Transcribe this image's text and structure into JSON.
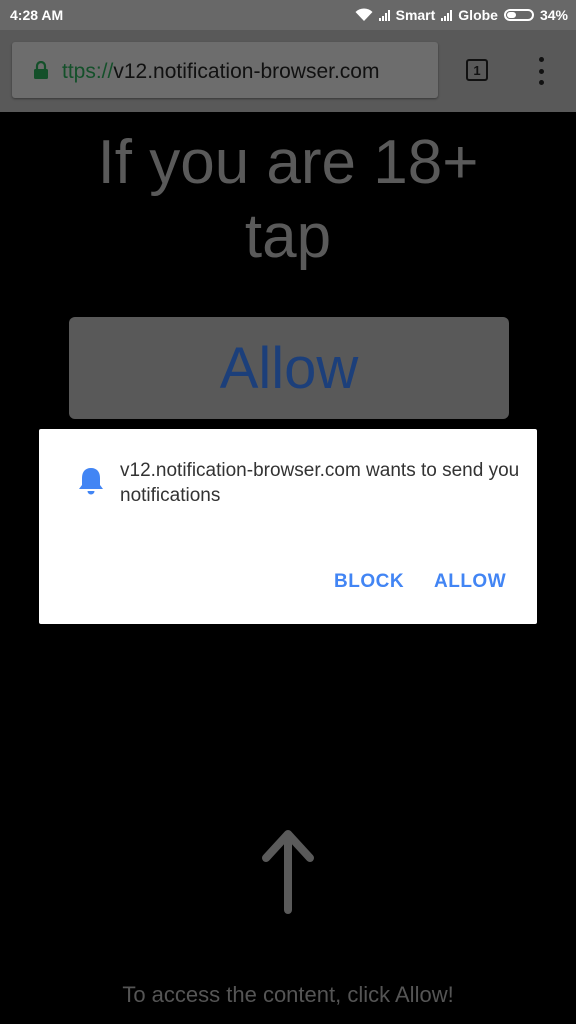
{
  "status_bar": {
    "time": "4:28 AM",
    "carrier1": "Smart",
    "carrier2": "Globe",
    "battery": "34%"
  },
  "browser": {
    "url_scheme": "ttps://",
    "url_host": "v12.notification-browser.com",
    "tab_count": "1"
  },
  "page": {
    "headline_line1": "If you are 18+",
    "headline_line2": "tap",
    "allow_button": "Allow",
    "footer": "To access the content, click Allow!"
  },
  "dialog": {
    "message": "v12.notification-browser.com wants to send you notifications",
    "block_label": "BLOCK",
    "allow_label": "ALLOW"
  },
  "colors": {
    "accent": "#4285f4",
    "lock": "#14502a",
    "page_allow_text": "#1c3f7a"
  },
  "icons": [
    "wifi-icon",
    "signal-icon",
    "battery-icon",
    "lock-icon",
    "tabs-icon",
    "menu-icon",
    "bell-icon",
    "arrow-up-icon"
  ]
}
